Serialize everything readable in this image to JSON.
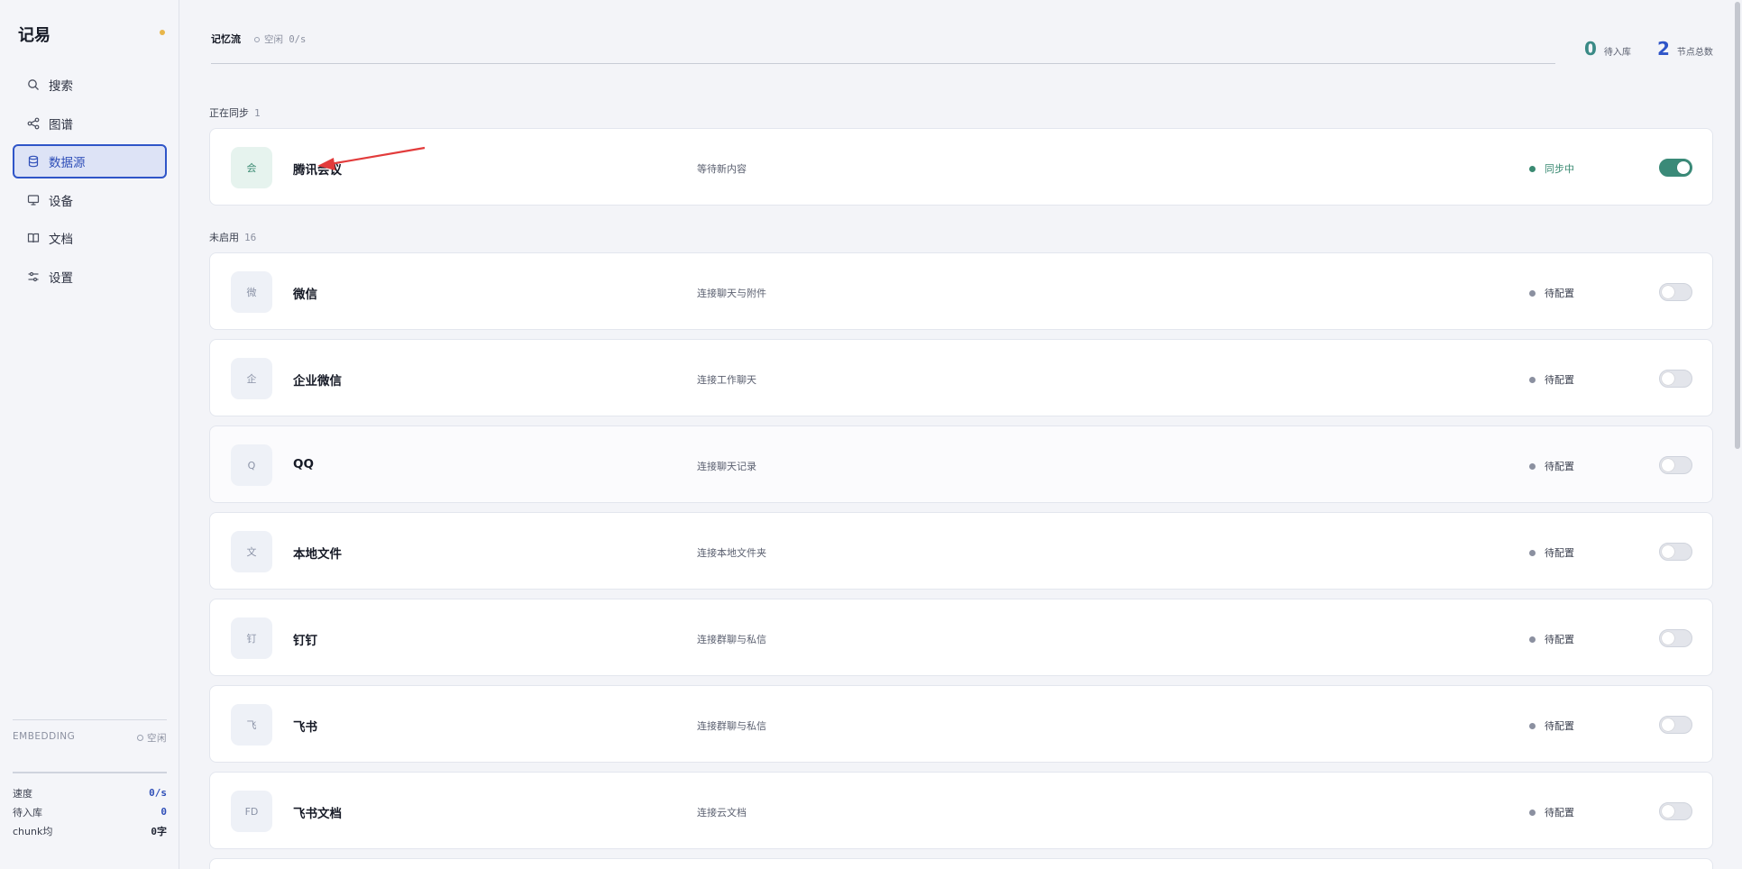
{
  "app": {
    "brand": "记易",
    "brand_dot_color": "#e8b64a"
  },
  "sidebar": {
    "items": [
      {
        "label": "搜索",
        "icon": "search-icon",
        "active": false
      },
      {
        "label": "图谱",
        "icon": "graph-icon",
        "active": false
      },
      {
        "label": "数据源",
        "icon": "database-icon",
        "active": true
      },
      {
        "label": "设备",
        "icon": "monitor-icon",
        "active": false
      },
      {
        "label": "文档",
        "icon": "book-icon",
        "active": false
      },
      {
        "label": "设置",
        "icon": "sliders-icon",
        "active": false
      }
    ],
    "embedding": {
      "label": "EMBEDDING",
      "status": "空闲"
    },
    "stats": [
      {
        "label": "速度",
        "value": "0/s"
      },
      {
        "label": "待入库",
        "value": "0"
      },
      {
        "label": "chunk均",
        "value": "0字"
      }
    ]
  },
  "header": {
    "tab": "记忆流",
    "status": "空闲 0/s",
    "metrics": [
      {
        "value": "0",
        "label": "待入库",
        "color": "#3a8a86"
      },
      {
        "value": "2",
        "label": "节点总数",
        "color": "#2f55c8"
      }
    ]
  },
  "sections": {
    "syncing": {
      "label": "正在同步",
      "count": "1"
    },
    "disabled": {
      "label": "未启用",
      "count": "16"
    }
  },
  "sources": [
    {
      "avatar": "会",
      "name": "腾讯会议",
      "desc": "等待新内容",
      "status": "同步中",
      "enabled": true
    },
    {
      "avatar": "微",
      "name": "微信",
      "desc": "连接聊天与附件",
      "status": "待配置",
      "enabled": false
    },
    {
      "avatar": "企",
      "name": "企业微信",
      "desc": "连接工作聊天",
      "status": "待配置",
      "enabled": false
    },
    {
      "avatar": "Q",
      "name": "QQ",
      "desc": "连接聊天记录",
      "status": "待配置",
      "enabled": false
    },
    {
      "avatar": "文",
      "name": "本地文件",
      "desc": "连接本地文件夹",
      "status": "待配置",
      "enabled": false
    },
    {
      "avatar": "钉",
      "name": "钉钉",
      "desc": "连接群聊与私信",
      "status": "待配置",
      "enabled": false
    },
    {
      "avatar": "飞",
      "name": "飞书",
      "desc": "连接群聊与私信",
      "status": "待配置",
      "enabled": false
    },
    {
      "avatar": "FD",
      "name": "飞书文档",
      "desc": "连接云文档",
      "status": "待配置",
      "enabled": false
    }
  ],
  "colors": {
    "accent": "#2f55c8",
    "sync_green": "#3a8a78",
    "annotation_arrow": "#e23b3b"
  }
}
